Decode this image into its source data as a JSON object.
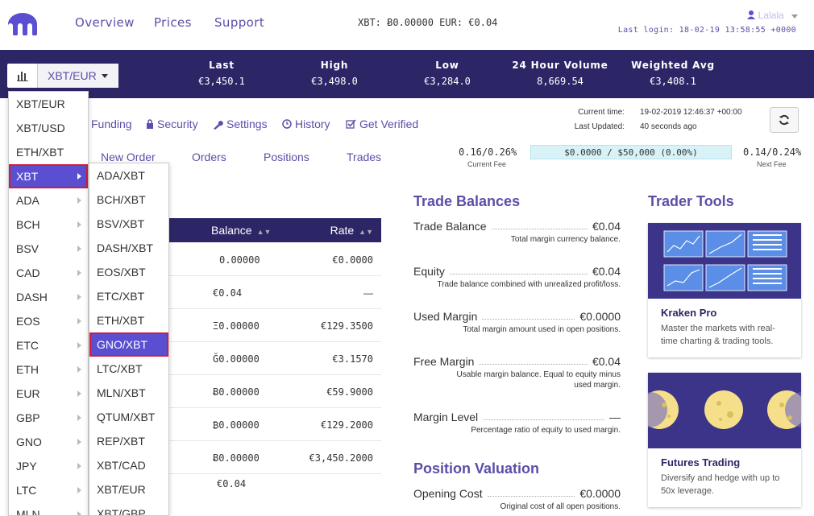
{
  "nav": {
    "links": [
      "Overview",
      "Prices",
      "Support"
    ],
    "balances": "XBT: Ƀ0.00000  EUR: €0.04",
    "username": "Lalala",
    "last_login": "Last login: 18-02-19 13:58:55 +0000"
  },
  "ticker": {
    "pair": "XBT/EUR",
    "stats": [
      {
        "label": "Last",
        "value": "€3,450.1"
      },
      {
        "label": "High",
        "value": "€3,498.0"
      },
      {
        "label": "Low",
        "value": "€3,284.0"
      },
      {
        "label": "24 Hour Volume",
        "value": "8,669.54"
      },
      {
        "label": "Weighted Avg",
        "value": "€3,408.1"
      }
    ]
  },
  "subnav": {
    "items": [
      "Funding",
      "Security",
      "Settings",
      "History",
      "Get Verified"
    ],
    "current_time_label": "Current time:",
    "current_time": "19-02-2019 12:46:37 +00:00",
    "last_updated_label": "Last Updated:",
    "last_updated": "40 seconds ago"
  },
  "tabs": [
    "New Order",
    "Orders",
    "Positions",
    "Trades"
  ],
  "fees": {
    "current": "0.16/0.26%",
    "current_label": "Current Fee",
    "bar": "$0.0000 / $50,000 (0.00%)",
    "next": "0.14/0.24%",
    "next_label": "Next Fee"
  },
  "table": {
    "headers": [
      "Balance",
      "Rate"
    ],
    "rows": [
      {
        "balance": "0.00000",
        "rate": "€0.0000"
      },
      {
        "balance": "€0.04",
        "rate": "—"
      },
      {
        "balance": "Ξ0.00000",
        "rate": "€129.3500"
      },
      {
        "balance": "Ğ0.00000",
        "rate": "€3.1570"
      },
      {
        "balance": "Ƀ0.00000",
        "rate": "€59.9000"
      },
      {
        "balance": "₿0.00000",
        "rate": "€129.2000"
      },
      {
        "balance": "Ƀ0.00000",
        "rate": "€3,450.2000"
      }
    ],
    "total": "€0.04"
  },
  "trade_balances": {
    "title": "Trade Balances",
    "items": [
      {
        "label": "Trade Balance",
        "value": "€0.04",
        "desc": "Total margin currency balance."
      },
      {
        "label": "Equity",
        "value": "€0.04",
        "desc": "Trade balance combined with unrealized profit/loss."
      },
      {
        "label": "Used Margin",
        "value": "€0.0000",
        "desc": "Total margin amount used in open positions."
      },
      {
        "label": "Free Margin",
        "value": "€0.04",
        "desc": "Usable margin balance. Equal to equity minus used margin."
      },
      {
        "label": "Margin Level",
        "value": "—",
        "desc": "Percentage ratio of equity to used margin."
      }
    ]
  },
  "position_valuation": {
    "title": "Position Valuation",
    "items": [
      {
        "label": "Opening Cost",
        "value": "€0.0000",
        "desc": "Original cost of all open positions."
      }
    ]
  },
  "trader_tools": {
    "title": "Trader Tools",
    "cards": [
      {
        "title": "Kraken Pro",
        "desc": "Master the markets with real-time charting & trading tools."
      },
      {
        "title": "Futures Trading",
        "desc": "Diversify and hedge with up to 50x leverage."
      }
    ]
  },
  "menu_primary": [
    "XBT/EUR",
    "XBT/USD",
    "ETH/XBT",
    "XBT",
    "ADA",
    "BCH",
    "BSV",
    "CAD",
    "DASH",
    "EOS",
    "ETC",
    "ETH",
    "EUR",
    "GBP",
    "GNO",
    "JPY",
    "LTC",
    "MLN"
  ],
  "menu_secondary": [
    "ADA/XBT",
    "BCH/XBT",
    "BSV/XBT",
    "DASH/XBT",
    "EOS/XBT",
    "ETC/XBT",
    "ETH/XBT",
    "GNO/XBT",
    "LTC/XBT",
    "MLN/XBT",
    "QTUM/XBT",
    "REP/XBT",
    "XBT/CAD",
    "XBT/EUR",
    "XBT/GBP"
  ],
  "colors": {
    "brand": "#5a4fa8",
    "header": "#2d2666",
    "highlight": "#5a4fd1",
    "outline": "#d21d3a"
  }
}
